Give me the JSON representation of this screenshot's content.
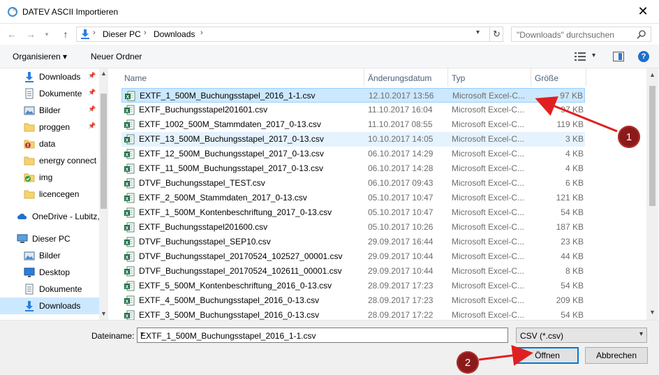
{
  "window": {
    "title": "DATEV ASCII Importieren",
    "close_glyph": "✕"
  },
  "address": {
    "crumbs": [
      "Dieser PC",
      "Downloads"
    ],
    "separator": "›",
    "search_placeholder": "\"Downloads\" durchsuchen"
  },
  "toolbar": {
    "organize_label": "Organisieren ▾",
    "new_folder_label": "Neuer Ordner",
    "help_label": "?"
  },
  "sidebar": {
    "items": [
      {
        "label": "Downloads",
        "icon": "download-arrow-icon",
        "pinned": true
      },
      {
        "label": "Dokumente",
        "icon": "document-icon",
        "pinned": true
      },
      {
        "label": "Bilder",
        "icon": "pictures-icon",
        "pinned": true
      },
      {
        "label": "proggen",
        "icon": "folder-icon",
        "pinned": true
      },
      {
        "label": "data",
        "icon": "folder-warning-icon",
        "pinned": false
      },
      {
        "label": "energy connect",
        "icon": "folder-icon",
        "pinned": false
      },
      {
        "label": "img",
        "icon": "folder-check-icon",
        "pinned": false
      },
      {
        "label": "licencegen",
        "icon": "folder-icon",
        "pinned": false
      },
      {
        "label": "OneDrive - Lubitz,",
        "icon": "onedrive-icon",
        "pinned": false
      },
      {
        "label": "Dieser PC",
        "icon": "computer-icon",
        "pinned": false
      },
      {
        "label": "Bilder",
        "icon": "pictures-icon",
        "pinned": false
      },
      {
        "label": "Desktop",
        "icon": "desktop-icon",
        "pinned": false
      },
      {
        "label": "Dokumente",
        "icon": "document-icon",
        "pinned": false
      },
      {
        "label": "Downloads",
        "icon": "download-arrow-icon",
        "pinned": false,
        "selected": true
      }
    ]
  },
  "columns": {
    "name": "Name",
    "date": "Änderungsdatum",
    "type": "Typ",
    "size": "Größe"
  },
  "files": [
    {
      "name": "EXTF_1_500M_Buchungsstapel_2016_1-1.csv",
      "date": "12.10.2017 13:56",
      "type": "Microsoft Excel-C...",
      "size": "97 KB",
      "state": "selected"
    },
    {
      "name": "EXTF_Buchungsstapel201601.csv",
      "date": "11.10.2017 16:04",
      "type": "Microsoft Excel-C...",
      "size": "97 KB",
      "state": ""
    },
    {
      "name": "EXTF_1002_500M_Stammdaten_2017_0-13.csv",
      "date": "11.10.2017 08:55",
      "type": "Microsoft Excel-C...",
      "size": "119 KB",
      "state": ""
    },
    {
      "name": "EXTF_13_500M_Buchungsstapel_2017_0-13.csv",
      "date": "10.10.2017 14:05",
      "type": "Microsoft Excel-C...",
      "size": "3 KB",
      "state": "hover"
    },
    {
      "name": "EXTF_12_500M_Buchungsstapel_2017_0-13.csv",
      "date": "06.10.2017 14:29",
      "type": "Microsoft Excel-C...",
      "size": "4 KB",
      "state": ""
    },
    {
      "name": "EXTF_11_500M_Buchungsstapel_2017_0-13.csv",
      "date": "06.10.2017 14:28",
      "type": "Microsoft Excel-C...",
      "size": "4 KB",
      "state": ""
    },
    {
      "name": "DTVF_Buchungsstapel_TEST.csv",
      "date": "06.10.2017 09:43",
      "type": "Microsoft Excel-C...",
      "size": "6 KB",
      "state": ""
    },
    {
      "name": "EXTF_2_500M_Stammdaten_2017_0-13.csv",
      "date": "05.10.2017 10:47",
      "type": "Microsoft Excel-C...",
      "size": "121 KB",
      "state": ""
    },
    {
      "name": "EXTF_1_500M_Kontenbeschriftung_2017_0-13.csv",
      "date": "05.10.2017 10:47",
      "type": "Microsoft Excel-C...",
      "size": "54 KB",
      "state": ""
    },
    {
      "name": "EXTF_Buchungsstapel201600.csv",
      "date": "05.10.2017 10:26",
      "type": "Microsoft Excel-C...",
      "size": "187 KB",
      "state": ""
    },
    {
      "name": "DTVF_Buchungsstapel_SEP10.csv",
      "date": "29.09.2017 16:44",
      "type": "Microsoft Excel-C...",
      "size": "23 KB",
      "state": ""
    },
    {
      "name": "DTVF_Buchungsstapel_20170524_102527_00001.csv",
      "date": "29.09.2017 10:44",
      "type": "Microsoft Excel-C...",
      "size": "44 KB",
      "state": ""
    },
    {
      "name": "DTVF_Buchungsstapel_20170524_102611_00001.csv",
      "date": "29.09.2017 10:44",
      "type": "Microsoft Excel-C...",
      "size": "8 KB",
      "state": ""
    },
    {
      "name": "EXTF_5_500M_Kontenbeschriftung_2016_0-13.csv",
      "date": "28.09.2017 17:23",
      "type": "Microsoft Excel-C...",
      "size": "54 KB",
      "state": ""
    },
    {
      "name": "EXTF_4_500M_Buchungsstapel_2016_0-13.csv",
      "date": "28.09.2017 17:23",
      "type": "Microsoft Excel-C...",
      "size": "209 KB",
      "state": ""
    },
    {
      "name": "EXTF_3_500M_Buchungsstapel_2016_0-13.csv",
      "date": "28.09.2017 17:22",
      "type": "Microsoft Excel-C...",
      "size": "54 KB",
      "state": ""
    }
  ],
  "footer": {
    "filename_label": "Dateiname:",
    "filename_value": "EXTF_1_500M_Buchungsstapel_2016_1-1.csv",
    "filetype_value": "CSV (*.csv)",
    "open_label": "Öffnen",
    "cancel_label": "Abbrechen"
  },
  "annotations": {
    "callout_1": "1",
    "callout_2": "2",
    "color": "#8b1a1a",
    "arrow_color": "#e02020"
  },
  "colors": {
    "selection": "#cce8ff",
    "hover": "#e5f3ff",
    "accent": "#0078d7",
    "excel_green": "#1d7044"
  }
}
